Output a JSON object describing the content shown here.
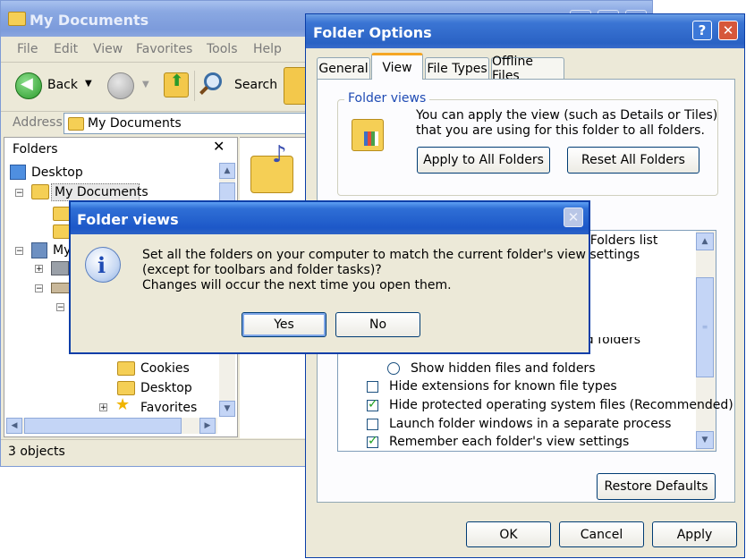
{
  "explorer": {
    "title": "My Documents",
    "menu": [
      "File",
      "Edit",
      "View",
      "Favorites",
      "Tools",
      "Help"
    ],
    "back_label": "Back",
    "search_label": "Search",
    "address_label": "Address",
    "address_value": "My Documents",
    "folders_label": "Folders",
    "tree": {
      "desktop": "Desktop",
      "my_documents": "My Documents",
      "my_computer": "My",
      "cookies": "Cookies",
      "desktop2": "Desktop",
      "favorites": "Favorites"
    },
    "status": "3 objects"
  },
  "folder_options": {
    "title": "Folder Options",
    "tabs": [
      "General",
      "View",
      "File Types",
      "Offline Files"
    ],
    "group_title": "Folder views",
    "group_text": "You can apply the view (such as Details or Tiles) that you are using for this folder to all folders.",
    "apply_all_label": "Apply to All Folders",
    "reset_all_label": "Reset All Folders",
    "partial_folders_list": "s Folders list",
    "partial_r": "r",
    "partial_hidden_struck": "Do not show hidden files and folders",
    "settings": [
      {
        "label": "Show hidden files and folders",
        "kind": "radio",
        "checked": false
      },
      {
        "label": "Hide extensions for known file types",
        "kind": "check",
        "checked": false
      },
      {
        "label": "Hide protected operating system files (Recommended)",
        "kind": "check",
        "checked": true
      },
      {
        "label": "Launch folder windows in a separate process",
        "kind": "check",
        "checked": false
      },
      {
        "label": "Remember each folder's view settings",
        "kind": "check",
        "checked": true
      }
    ],
    "restore_label": "Restore Defaults",
    "ok_label": "OK",
    "cancel_label": "Cancel",
    "apply_label": "Apply"
  },
  "dialog": {
    "title": "Folder views",
    "line1": "Set all the folders on your computer to match the current folder's view settings",
    "line2": "(except for toolbars and folder tasks)?",
    "line3": "Changes will occur the next time you open them.",
    "yes_label": "Yes",
    "no_label": "No"
  },
  "colors": {
    "title_active": "#1d58c8",
    "window_face": "#ece9d8",
    "check_green": "#21a121"
  }
}
